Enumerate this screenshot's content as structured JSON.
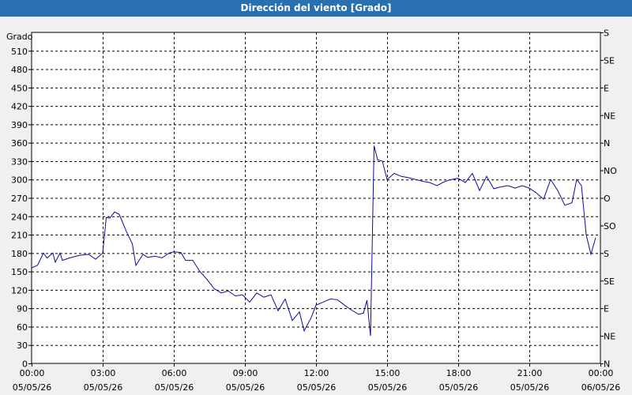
{
  "colors": {
    "title_bg": "#2a6fb0",
    "title_text": "#ffffff",
    "series": "#0a0aa0",
    "background": "#f0f0f0",
    "plot_bg": "#ffffff"
  },
  "chart_data": {
    "type": "line",
    "title": "Dirección del viento [Grado]",
    "ylabel": "Grado",
    "ylim": [
      0,
      540
    ],
    "yticks": [
      0,
      30,
      60,
      90,
      120,
      150,
      180,
      210,
      240,
      270,
      300,
      330,
      360,
      390,
      420,
      450,
      480,
      510
    ],
    "right_axis_labels": [
      {
        "value": 0,
        "label": "N"
      },
      {
        "value": 45,
        "label": "NE"
      },
      {
        "value": 90,
        "label": "E"
      },
      {
        "value": 135,
        "label": "SE"
      },
      {
        "value": 180,
        "label": "S"
      },
      {
        "value": 225,
        "label": "SO"
      },
      {
        "value": 270,
        "label": "O"
      },
      {
        "value": 315,
        "label": "NO"
      },
      {
        "value": 360,
        "label": "N"
      },
      {
        "value": 405,
        "label": "NE"
      },
      {
        "value": 450,
        "label": "E"
      },
      {
        "value": 495,
        "label": "SE"
      },
      {
        "value": 540,
        "label": "S"
      }
    ],
    "xlim": [
      0,
      24
    ],
    "xticks": [
      {
        "x": 0,
        "time": "00:00",
        "date": "05/05/26"
      },
      {
        "x": 3,
        "time": "03:00",
        "date": "05/05/26"
      },
      {
        "x": 6,
        "time": "06:00",
        "date": "05/05/26"
      },
      {
        "x": 9,
        "time": "09:00",
        "date": "05/05/26"
      },
      {
        "x": 12,
        "time": "12:00",
        "date": "05/05/26"
      },
      {
        "x": 15,
        "time": "15:00",
        "date": "05/05/26"
      },
      {
        "x": 18,
        "time": "18:00",
        "date": "05/05/26"
      },
      {
        "x": 21,
        "time": "21:00",
        "date": "05/05/26"
      },
      {
        "x": 24,
        "time": "00:00",
        "date": "06/05/26"
      }
    ],
    "grid": true,
    "series": [
      {
        "x": [
          0,
          0.25,
          0.5,
          0.65,
          0.9,
          1.0,
          1.2,
          1.3,
          1.6,
          2.0,
          2.4,
          2.7,
          3.0,
          3.15,
          3.3,
          3.5,
          3.7,
          4.0,
          4.25,
          4.4,
          4.7,
          4.9,
          5.2,
          5.5,
          5.8,
          6.0,
          6.3,
          6.5,
          6.8,
          7.1,
          7.4,
          7.7,
          8.0,
          8.3,
          8.6,
          8.9,
          9.2,
          9.5,
          9.8,
          10.1,
          10.4,
          10.7,
          11.0,
          11.3,
          11.5,
          11.8,
          12.0,
          12.3,
          12.6,
          12.9,
          13.2,
          13.5,
          13.8,
          14.0,
          14.15,
          14.3,
          14.45,
          14.6,
          14.8,
          15.0,
          15.3,
          15.6,
          15.9,
          16.2,
          16.5,
          16.8,
          17.1,
          17.4,
          17.7,
          18.0,
          18.3,
          18.6,
          18.9,
          19.2,
          19.5,
          19.8,
          20.1,
          20.4,
          20.7,
          21.0,
          21.3,
          21.6,
          21.9,
          22.2,
          22.5,
          22.8,
          23.0,
          23.2,
          23.4,
          23.6,
          23.8
        ],
        "y": [
          156,
          160,
          180,
          172,
          180,
          165,
          180,
          168,
          172,
          176,
          178,
          170,
          180,
          238,
          237,
          247,
          243,
          215,
          195,
          160,
          178,
          173,
          175,
          172,
          180,
          182,
          181,
          168,
          168,
          150,
          137,
          122,
          115,
          118,
          110,
          112,
          100,
          115,
          108,
          112,
          86,
          105,
          70,
          84,
          53,
          75,
          95,
          100,
          105,
          104,
          95,
          87,
          80,
          82,
          103,
          45,
          355,
          332,
          330,
          300,
          310,
          305,
          303,
          300,
          297,
          295,
          290,
          296,
          300,
          302,
          295,
          310,
          282,
          305,
          285,
          288,
          290,
          286,
          290,
          286,
          278,
          268,
          300,
          282,
          258,
          262,
          300,
          290,
          210,
          178,
          205
        ]
      }
    ]
  }
}
